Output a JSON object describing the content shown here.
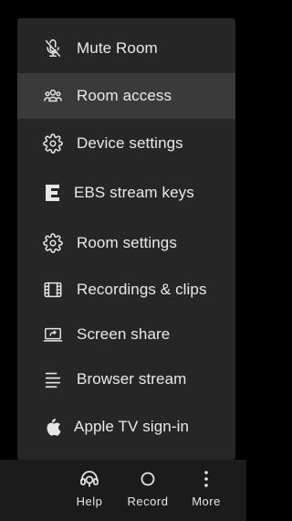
{
  "menu": {
    "items": [
      {
        "label": "Mute Room",
        "icon": "mic-off-icon"
      },
      {
        "label": "Room access",
        "icon": "users-icon",
        "active": true
      },
      {
        "label": "Device settings",
        "icon": "gear-icon"
      },
      {
        "label": "EBS stream keys",
        "icon": "ebs-logo-icon"
      },
      {
        "label": "Room settings",
        "icon": "gear-icon"
      },
      {
        "label": "Recordings & clips",
        "icon": "film-icon"
      },
      {
        "label": "Screen share",
        "icon": "screen-share-icon"
      },
      {
        "label": "Browser stream",
        "icon": "lines-icon"
      },
      {
        "label": "Apple TV sign-in",
        "icon": "apple-icon"
      }
    ]
  },
  "bottom_bar": {
    "help": {
      "label": "Help",
      "icon": "help-headset-icon"
    },
    "record": {
      "label": "Record",
      "icon": "record-circle-icon"
    },
    "more": {
      "label": "More",
      "icon": "more-vertical-icon"
    }
  },
  "colors": {
    "background": "#000000",
    "menu_bg": "#262626",
    "menu_active_bg": "#3a3a3a",
    "bar_bg": "#1b1b1b",
    "text": "#eaeaea"
  }
}
